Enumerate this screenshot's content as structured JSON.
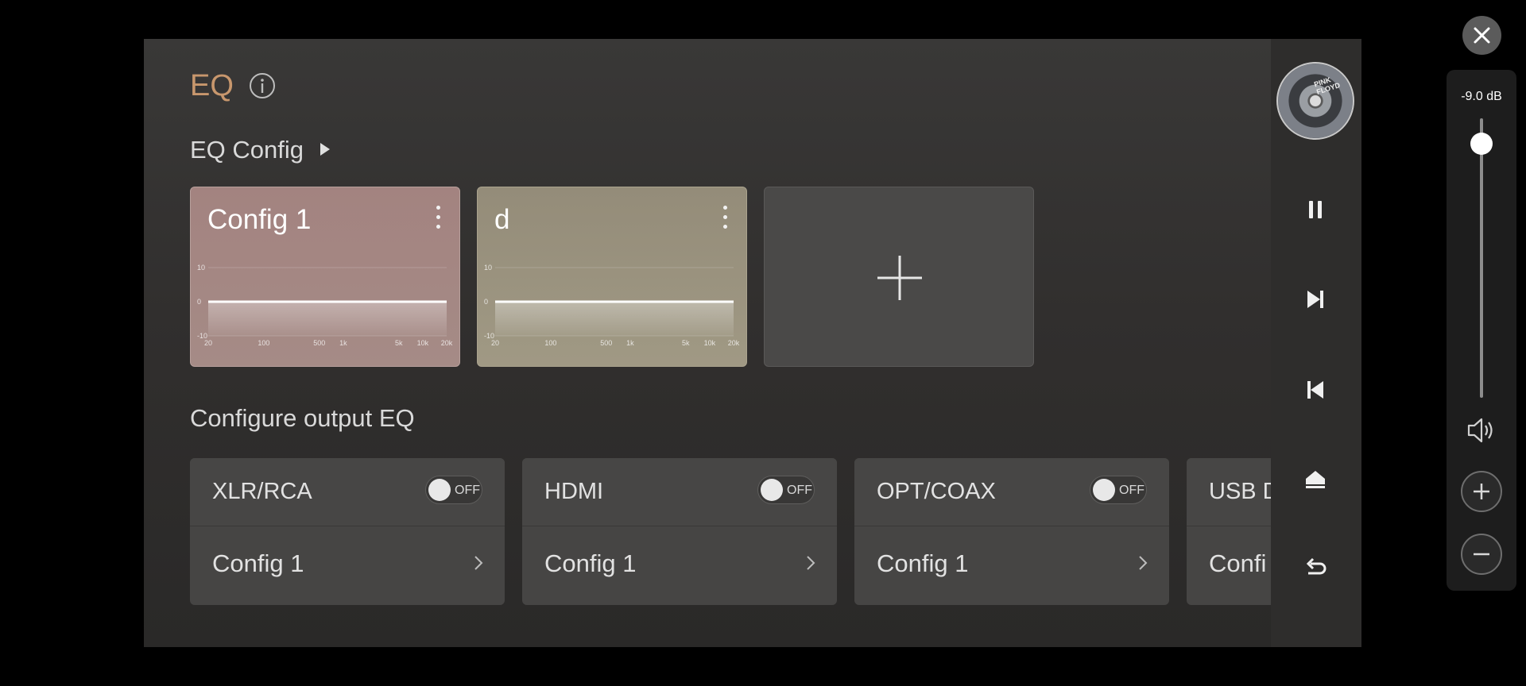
{
  "header": {
    "title": "EQ",
    "config_section": "EQ Config",
    "output_section": "Configure output EQ"
  },
  "eq_configs": [
    {
      "name": "Config 1",
      "color": "#a38380",
      "graph": {
        "y_ticks": [
          "10",
          "0",
          "-10"
        ],
        "x_ticks": [
          "20",
          "100",
          "500",
          "1k",
          "5k",
          "10k",
          "20k"
        ],
        "gain_db": 0
      }
    },
    {
      "name": "d",
      "color": "#948c79",
      "graph": {
        "y_ticks": [
          "10",
          "0",
          "-10"
        ],
        "x_ticks": [
          "20",
          "100",
          "500",
          "1k",
          "5k",
          "10k",
          "20k"
        ],
        "gain_db": 0
      }
    }
  ],
  "outputs": [
    {
      "name": "XLR/RCA",
      "toggle": "OFF",
      "config": "Config 1"
    },
    {
      "name": "HDMI",
      "toggle": "OFF",
      "config": "Config 1"
    },
    {
      "name": "OPT/COAX",
      "toggle": "OFF",
      "config": "Config 1"
    },
    {
      "name": "USB D",
      "toggle": "",
      "config": "Confi"
    }
  ],
  "media": {
    "album_label": "PINK FLOYD",
    "controls": [
      "pause-icon",
      "skip-next-icon",
      "skip-previous-icon",
      "home-icon",
      "back-icon"
    ]
  },
  "volume": {
    "readout": "-9.0 dB",
    "level_fraction": 0.91
  },
  "icons": {
    "info": "info-icon",
    "add": "plus-icon",
    "close": "close-icon",
    "speaker": "speaker-icon",
    "volume_up": "plus-icon",
    "volume_down": "minus-icon"
  },
  "colors": {
    "accent": "#c8976d",
    "background": "#333231"
  }
}
